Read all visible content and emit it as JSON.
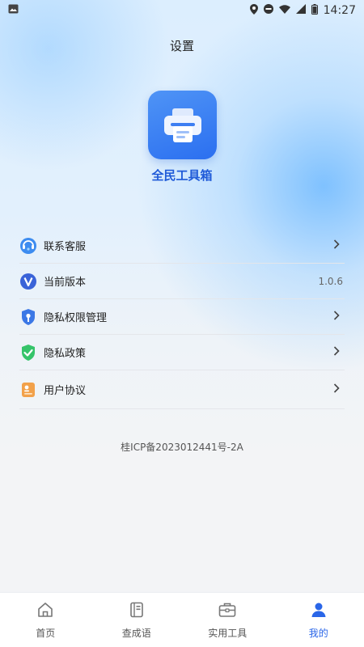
{
  "status_bar": {
    "time": "14:27"
  },
  "header": {
    "title": "设置"
  },
  "app": {
    "name": "全民工具箱"
  },
  "menu": [
    {
      "label": "联系客服",
      "icon": "customer-service-icon",
      "trailing": "chevron"
    },
    {
      "label": "当前版本",
      "icon": "version-icon",
      "value": "1.0.6"
    },
    {
      "label": "隐私权限管理",
      "icon": "privacy-permission-icon",
      "trailing": "chevron"
    },
    {
      "label": "隐私政策",
      "icon": "privacy-policy-icon",
      "trailing": "chevron"
    },
    {
      "label": "用户协议",
      "icon": "user-agreement-icon",
      "trailing": "chevron"
    }
  ],
  "footer": {
    "icp": "桂ICP备2023012441号-2A"
  },
  "tabbar": {
    "items": [
      {
        "label": "首页",
        "icon": "home-icon",
        "active": false
      },
      {
        "label": "查成语",
        "icon": "idiom-book-icon",
        "active": false
      },
      {
        "label": "实用工具",
        "icon": "toolbox-icon",
        "active": false
      },
      {
        "label": "我的",
        "icon": "profile-icon",
        "active": true
      }
    ]
  },
  "colors": {
    "accent": "#2a66e8",
    "app_icon": "#3b82f6"
  }
}
